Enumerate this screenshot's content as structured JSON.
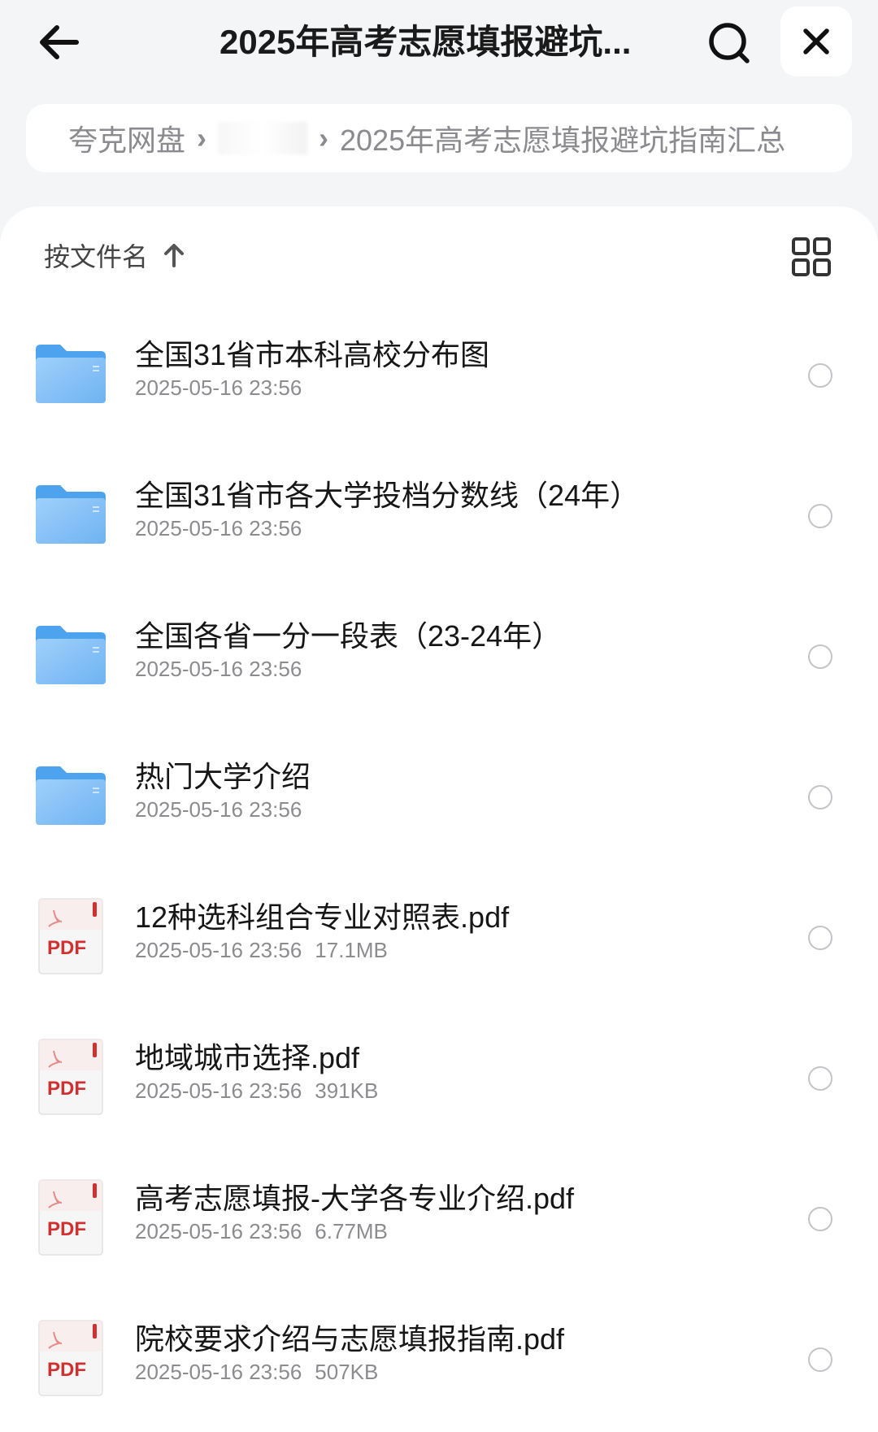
{
  "header": {
    "title": "2025年高考志愿填报避坑...",
    "back_icon": "arrow-left-icon",
    "search_icon": "search-icon",
    "close_icon": "close-icon"
  },
  "breadcrumb": {
    "root": "夸克网盘",
    "separator": "›",
    "current": "2025年高考志愿填报避坑指南汇总"
  },
  "toolbar": {
    "sort_label": "按文件名",
    "sort_icon": "arrow-up-icon",
    "view_icon": "grid-view-icon"
  },
  "files": [
    {
      "name": "全国31省市本科高校分布图",
      "date": "2025-05-16 23:56",
      "size": "",
      "type": "folder"
    },
    {
      "name": "全国31省市各大学投档分数线（24年）",
      "date": "2025-05-16 23:56",
      "size": "",
      "type": "folder"
    },
    {
      "name": "全国各省一分一段表（23-24年）",
      "date": "2025-05-16 23:56",
      "size": "",
      "type": "folder"
    },
    {
      "name": "热门大学介绍",
      "date": "2025-05-16 23:56",
      "size": "",
      "type": "folder"
    },
    {
      "name": "12种选科组合专业对照表.pdf",
      "date": "2025-05-16 23:56",
      "size": "17.1MB",
      "type": "pdf"
    },
    {
      "name": "地域城市选择.pdf",
      "date": "2025-05-16 23:56",
      "size": "391KB",
      "type": "pdf"
    },
    {
      "name": "高考志愿填报-大学各专业介绍.pdf",
      "date": "2025-05-16 23:56",
      "size": "6.77MB",
      "type": "pdf"
    },
    {
      "name": "院校要求介绍与志愿填报指南.pdf",
      "date": "2025-05-16 23:56",
      "size": "507KB",
      "type": "pdf"
    }
  ],
  "labels": {
    "pdf_badge": "PDF"
  },
  "colors": {
    "folder_blue": "#7cbcf5",
    "pdf_red": "#d0302f",
    "background": "#f4f5f7"
  }
}
